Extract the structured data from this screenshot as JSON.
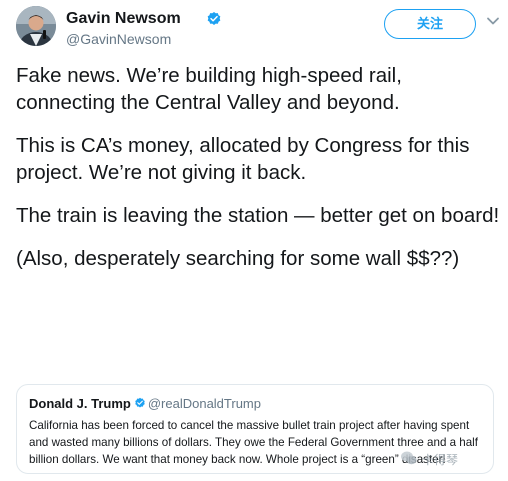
{
  "author": {
    "display_name": "Gavin Newsom",
    "handle": "@GavinNewsom",
    "avatar_icon": "avatar-photo",
    "verified_icon": "verified-badge-icon"
  },
  "actions": {
    "follow_label": "关注",
    "more_icon": "chevron-down-icon"
  },
  "tweet": {
    "paragraphs": [
      "Fake news. We’re building high-speed rail, connecting the Central Valley and beyond.",
      "This is CA’s money, allocated by Congress for this project. We’re not giving it back.",
      "The train is leaving the station — better get on board!",
      "(Also, desperately searching for some wall $$??)"
    ]
  },
  "quoted_tweet": {
    "display_name": "Donald J. Trump",
    "handle": "@realDonaldTrump",
    "text": "California has been forced to cancel the massive bullet train project after having spent and wasted many billions of dollars. They owe the Federal Government three and a half billion dollars. We want that money back now. Whole project is a “green” disaster!"
  },
  "watermark": {
    "text": "卡得琴"
  },
  "colors": {
    "accent": "#1da1f2",
    "text": "#14171a",
    "muted": "#657786",
    "border": "#e1e8ed"
  }
}
